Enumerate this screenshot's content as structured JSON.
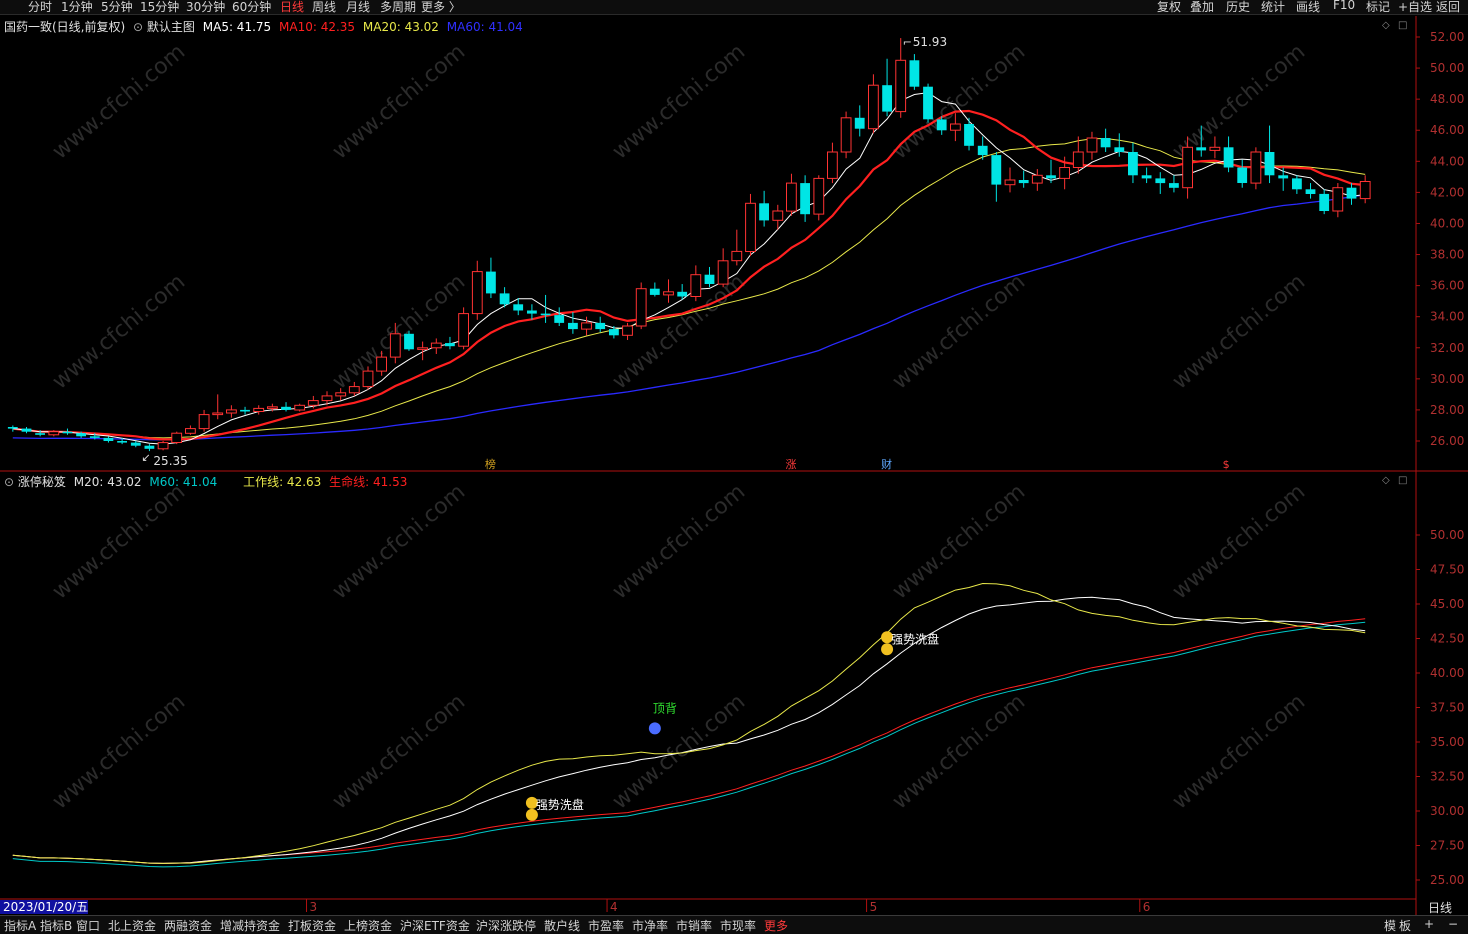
{
  "topbar": {
    "periods": [
      "分时",
      "1分钟",
      "5分钟",
      "15分钟",
      "30分钟",
      "60分钟",
      "日线",
      "周线",
      "月线",
      "多周期",
      "更多 〉"
    ],
    "active_period": "日线",
    "right_buttons": [
      "复权",
      "叠加",
      "历史",
      "统计",
      "画线",
      "F10",
      "标记",
      "+自选",
      "返回"
    ]
  },
  "main_panel": {
    "title": "国药一致(日线,前复权)",
    "template": "默认主图",
    "ma5_label": "MA5: 41.75",
    "ma10_label": "MA10: 42.35",
    "ma20_label": "MA20: 43.02",
    "ma60_label": "MA60: 41.04",
    "high_label": "51.93",
    "low_label": "25.35",
    "markers": [
      "榜",
      "涨",
      "财",
      "$"
    ],
    "price_ticks": [
      "52.00",
      "50.00",
      "48.00",
      "46.00",
      "44.00",
      "42.00",
      "40.00",
      "38.00",
      "36.00",
      "34.00",
      "32.00",
      "30.00",
      "28.00",
      "26.00"
    ]
  },
  "sub_panel": {
    "name": "涨停秘笈",
    "m20_label": "M20: 43.02",
    "m60_label": "M60: 41.04",
    "work_line_label": "工作线: 42.63",
    "life_line_label": "生命线: 41.53",
    "signals": [
      "强势洗盘",
      "顶背",
      "强势洗盘"
    ],
    "ticks": [
      "50.00",
      "47.50",
      "45.00",
      "42.50",
      "40.00",
      "37.50",
      "35.00",
      "32.50",
      "30.00",
      "27.50",
      "25.00"
    ]
  },
  "x_axis": {
    "start_date": "2023/01/20/五",
    "month_labels": [
      "3",
      "4",
      "5",
      "6"
    ]
  },
  "bottombar": {
    "tabs": [
      "指标A",
      "指标B",
      "窗口",
      "北上资金",
      "两融资金",
      "增减持资金",
      "打板资金",
      "上榜资金",
      "沪深ETF资金",
      "沪深涨跌停",
      "散户线",
      "市盈率",
      "市净率",
      "市销率",
      "市现率",
      "更多"
    ],
    "right": [
      "模",
      "板",
      "+",
      "−"
    ]
  },
  "right_corner": "日线",
  "watermark": "www.cfchi.com",
  "colors": {
    "up": "#ff3333",
    "down": "#00e5e5",
    "ma5": "#ffffff",
    "ma10": "#ff2020",
    "ma20": "#e8e84a",
    "ma60": "#2a2aff",
    "axis_red": "#b01010",
    "sub_work": "#e8e84a",
    "sub_life": "#ff2020",
    "sub_m60": "#00c8c8"
  },
  "chart_data": {
    "type": "candlestick",
    "ohlc": [
      [
        26.9,
        27.0,
        26.6,
        26.8
      ],
      [
        26.8,
        26.9,
        26.5,
        26.6
      ],
      [
        26.5,
        26.7,
        26.3,
        26.4
      ],
      [
        26.4,
        26.7,
        26.3,
        26.6
      ],
      [
        26.6,
        26.8,
        26.4,
        26.5
      ],
      [
        26.5,
        26.6,
        26.2,
        26.3
      ],
      [
        26.3,
        26.5,
        26.1,
        26.2
      ],
      [
        26.2,
        26.3,
        25.9,
        26.0
      ],
      [
        26.0,
        26.2,
        25.8,
        25.9
      ],
      [
        25.9,
        26.0,
        25.6,
        25.7
      ],
      [
        25.7,
        25.8,
        25.35,
        25.5
      ],
      [
        25.5,
        26.0,
        25.4,
        25.9
      ],
      [
        25.9,
        26.6,
        25.8,
        26.5
      ],
      [
        26.5,
        27.0,
        26.4,
        26.8
      ],
      [
        26.8,
        28.0,
        26.6,
        27.7
      ],
      [
        27.7,
        29.0,
        27.4,
        27.8
      ],
      [
        27.8,
        28.3,
        27.5,
        28.0
      ],
      [
        28.0,
        28.2,
        27.7,
        27.9
      ],
      [
        27.9,
        28.3,
        27.7,
        28.1
      ],
      [
        28.1,
        28.4,
        27.9,
        28.2
      ],
      [
        28.2,
        28.5,
        27.9,
        28.0
      ],
      [
        28.0,
        28.4,
        27.9,
        28.3
      ],
      [
        28.3,
        28.9,
        28.1,
        28.6
      ],
      [
        28.6,
        29.2,
        28.3,
        28.9
      ],
      [
        28.9,
        29.4,
        28.6,
        29.1
      ],
      [
        29.1,
        29.8,
        28.9,
        29.5
      ],
      [
        29.5,
        30.8,
        29.3,
        30.5
      ],
      [
        30.5,
        31.8,
        30.2,
        31.4
      ],
      [
        31.4,
        33.6,
        31.0,
        32.9
      ],
      [
        32.9,
        33.1,
        31.8,
        31.9
      ],
      [
        31.9,
        32.4,
        31.2,
        32.0
      ],
      [
        32.0,
        32.6,
        31.6,
        32.3
      ],
      [
        32.3,
        32.7,
        31.9,
        32.1
      ],
      [
        32.1,
        34.6,
        31.9,
        34.2
      ],
      [
        34.2,
        37.6,
        33.8,
        36.9
      ],
      [
        36.9,
        37.8,
        35.2,
        35.5
      ],
      [
        35.5,
        35.9,
        34.6,
        34.8
      ],
      [
        34.8,
        35.2,
        34.1,
        34.4
      ],
      [
        34.4,
        34.8,
        33.8,
        34.2
      ],
      [
        34.2,
        35.4,
        33.6,
        34.1
      ],
      [
        34.1,
        34.6,
        33.4,
        33.6
      ],
      [
        33.6,
        34.3,
        32.9,
        33.2
      ],
      [
        33.2,
        34.0,
        32.8,
        33.6
      ],
      [
        33.6,
        34.0,
        33.0,
        33.2
      ],
      [
        33.2,
        33.4,
        32.6,
        32.8
      ],
      [
        32.8,
        33.6,
        32.5,
        33.4
      ],
      [
        33.4,
        36.2,
        33.2,
        35.8
      ],
      [
        35.8,
        36.2,
        35.3,
        35.4
      ],
      [
        35.4,
        36.4,
        34.9,
        35.6
      ],
      [
        35.6,
        36.1,
        35.1,
        35.3
      ],
      [
        35.3,
        37.3,
        35.0,
        36.7
      ],
      [
        36.7,
        37.2,
        35.9,
        36.1
      ],
      [
        36.1,
        38.4,
        35.9,
        37.6
      ],
      [
        37.6,
        39.6,
        37.3,
        38.2
      ],
      [
        38.2,
        41.9,
        37.9,
        41.3
      ],
      [
        41.3,
        42.1,
        39.8,
        40.2
      ],
      [
        40.2,
        41.2,
        39.6,
        40.8
      ],
      [
        40.8,
        43.2,
        40.5,
        42.6
      ],
      [
        42.6,
        43.1,
        40.1,
        40.6
      ],
      [
        40.6,
        43.1,
        40.2,
        42.9
      ],
      [
        42.9,
        45.2,
        42.6,
        44.6
      ],
      [
        44.6,
        47.2,
        44.2,
        46.8
      ],
      [
        46.8,
        47.6,
        45.6,
        46.1
      ],
      [
        46.1,
        49.6,
        45.8,
        48.9
      ],
      [
        48.9,
        50.6,
        46.9,
        47.2
      ],
      [
        47.2,
        51.93,
        46.8,
        50.5
      ],
      [
        50.5,
        50.9,
        48.6,
        48.8
      ],
      [
        48.8,
        49.0,
        46.5,
        46.7
      ],
      [
        46.7,
        46.9,
        45.7,
        46.0
      ],
      [
        46.0,
        47.1,
        45.3,
        46.4
      ],
      [
        46.4,
        46.8,
        44.7,
        45.0
      ],
      [
        45.0,
        45.6,
        44.1,
        44.4
      ],
      [
        44.4,
        44.6,
        41.4,
        42.5
      ],
      [
        42.5,
        43.6,
        42.0,
        42.8
      ],
      [
        42.8,
        43.4,
        42.3,
        42.6
      ],
      [
        42.6,
        43.5,
        42.1,
        43.1
      ],
      [
        43.1,
        44.1,
        42.6,
        42.9
      ],
      [
        42.9,
        44.3,
        42.2,
        43.6
      ],
      [
        43.6,
        45.6,
        43.2,
        44.6
      ],
      [
        44.6,
        45.9,
        44.1,
        45.5
      ],
      [
        45.5,
        46.1,
        44.6,
        44.9
      ],
      [
        44.9,
        45.8,
        44.3,
        44.6
      ],
      [
        44.6,
        45.2,
        42.6,
        43.1
      ],
      [
        43.1,
        43.6,
        42.6,
        42.9
      ],
      [
        42.9,
        43.3,
        41.9,
        42.6
      ],
      [
        42.6,
        43.1,
        42.0,
        42.3
      ],
      [
        42.3,
        45.6,
        41.6,
        44.9
      ],
      [
        44.9,
        46.3,
        44.3,
        44.7
      ],
      [
        44.7,
        45.6,
        44.2,
        44.9
      ],
      [
        44.9,
        45.6,
        43.3,
        43.6
      ],
      [
        43.6,
        44.1,
        42.3,
        42.6
      ],
      [
        42.6,
        44.9,
        42.2,
        44.6
      ],
      [
        44.6,
        46.3,
        42.6,
        43.1
      ],
      [
        43.1,
        43.6,
        42.1,
        42.9
      ],
      [
        42.9,
        43.1,
        41.9,
        42.2
      ],
      [
        42.2,
        42.6,
        41.6,
        41.9
      ],
      [
        41.9,
        42.2,
        40.6,
        40.8
      ],
      [
        40.8,
        42.6,
        40.4,
        42.3
      ],
      [
        42.3,
        42.6,
        41.2,
        41.6
      ],
      [
        41.6,
        43.1,
        41.3,
        42.7
      ]
    ],
    "ylim": [
      25,
      53
    ],
    "sub_ylim": [
      24,
      53
    ]
  }
}
